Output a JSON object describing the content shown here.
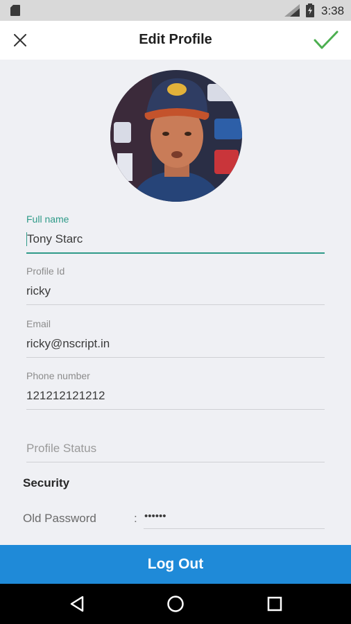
{
  "status_bar": {
    "time": "3:38",
    "icons": [
      "sd-card-icon",
      "signal-icon",
      "battery-icon"
    ]
  },
  "app_bar": {
    "title": "Edit Profile",
    "close_icon": "close-icon",
    "save_icon": "checkmark-icon",
    "accent_color": "#4caf50"
  },
  "profile": {
    "avatar_alt": "avatar"
  },
  "fields": {
    "full_name": {
      "label": "Full name",
      "value": "Tony Starc"
    },
    "profile_id": {
      "label": "Profile Id",
      "value": "ricky"
    },
    "email": {
      "label": "Email",
      "value": "ricky@nscript.in"
    },
    "phone": {
      "label": "Phone number",
      "value": "121212121212"
    },
    "status": {
      "placeholder": "Profile Status"
    }
  },
  "security": {
    "title": "Security",
    "old_password_label": "Old Password",
    "separator": ":",
    "old_password_value": "••••••"
  },
  "logout_label": "Log Out",
  "colors": {
    "accent_teal": "#2e9a88",
    "button_blue": "#1f8ad8",
    "background": "#eff0f4"
  },
  "nav": [
    "back-icon",
    "home-icon",
    "recents-icon"
  ]
}
